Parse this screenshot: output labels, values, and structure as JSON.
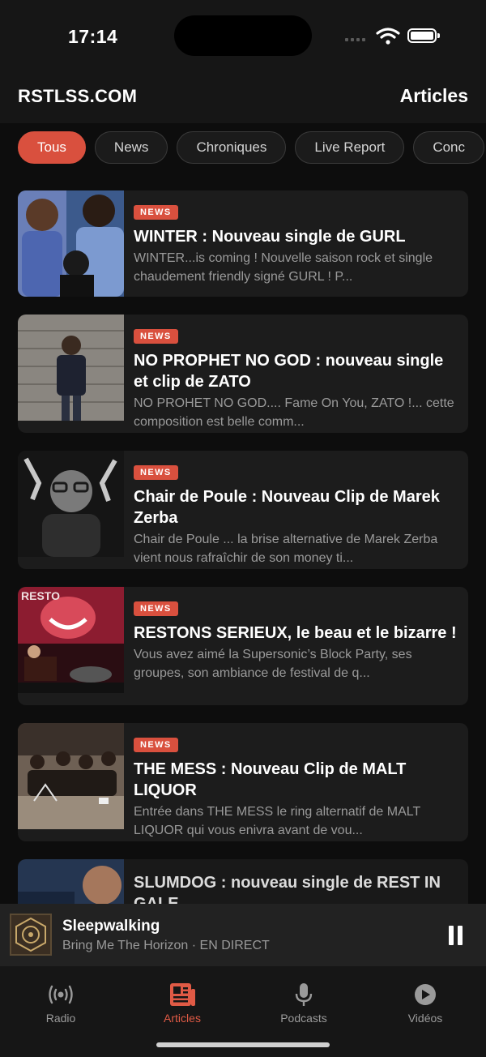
{
  "status": {
    "time": "17:14"
  },
  "header": {
    "logo": "RSTLSS.COM",
    "title": "Articles"
  },
  "filters": [
    "Tous",
    "News",
    "Chroniques",
    "Live Report",
    "Conc"
  ],
  "active_filter": "Tous",
  "articles": [
    {
      "badge": "NEWS",
      "title": "WINTER : Nouveau single de GURL",
      "excerpt": "WINTER...is coming ! Nouvelle saison rock et single chaudement friendly signé GURL !   P..."
    },
    {
      "badge": "NEWS",
      "title": "NO PROPHET NO GOD : nouveau single et clip de ZATO",
      "excerpt": "NO PROHET NO GOD.... Fame On You, ZATO !... cette composition est belle comm..."
    },
    {
      "badge": "NEWS",
      "title": "Chair de Poule : Nouveau Clip de Marek Zerba",
      "excerpt": "Chair de Poule ... la brise alternative de Marek Zerba vient nous rafraîchir de son money ti..."
    },
    {
      "badge": "NEWS",
      "title": "RESTONS SERIEUX, le beau et le bizarre !",
      "excerpt": "Vous avez aimé la Supersonic’s Block Party, ses groupes, son ambiance de festival de q..."
    },
    {
      "badge": "NEWS",
      "title": "THE MESS : Nouveau Clip de MALT LIQUOR",
      "excerpt": "Entrée dans THE MESS le ring alternatif de MALT LIQUOR qui vous enivra avant de vou..."
    },
    {
      "badge": "",
      "title": "SLUMDOG : nouveau single de REST IN GALE",
      "excerpt": ""
    }
  ],
  "player": {
    "track": "Sleepwalking",
    "artist": "Bring Me The Horizon · EN DIRECT"
  },
  "tabs": [
    {
      "label": "Radio",
      "icon": "radio-waves-icon"
    },
    {
      "label": "Articles",
      "icon": "newspaper-icon"
    },
    {
      "label": "Podcasts",
      "icon": "microphone-icon"
    },
    {
      "label": "Vidéos",
      "icon": "play-circle-icon"
    }
  ],
  "active_tab": "Articles",
  "colors": {
    "accent": "#d9503e",
    "background": "#0d0d0d",
    "card": "#1c1c1c"
  }
}
